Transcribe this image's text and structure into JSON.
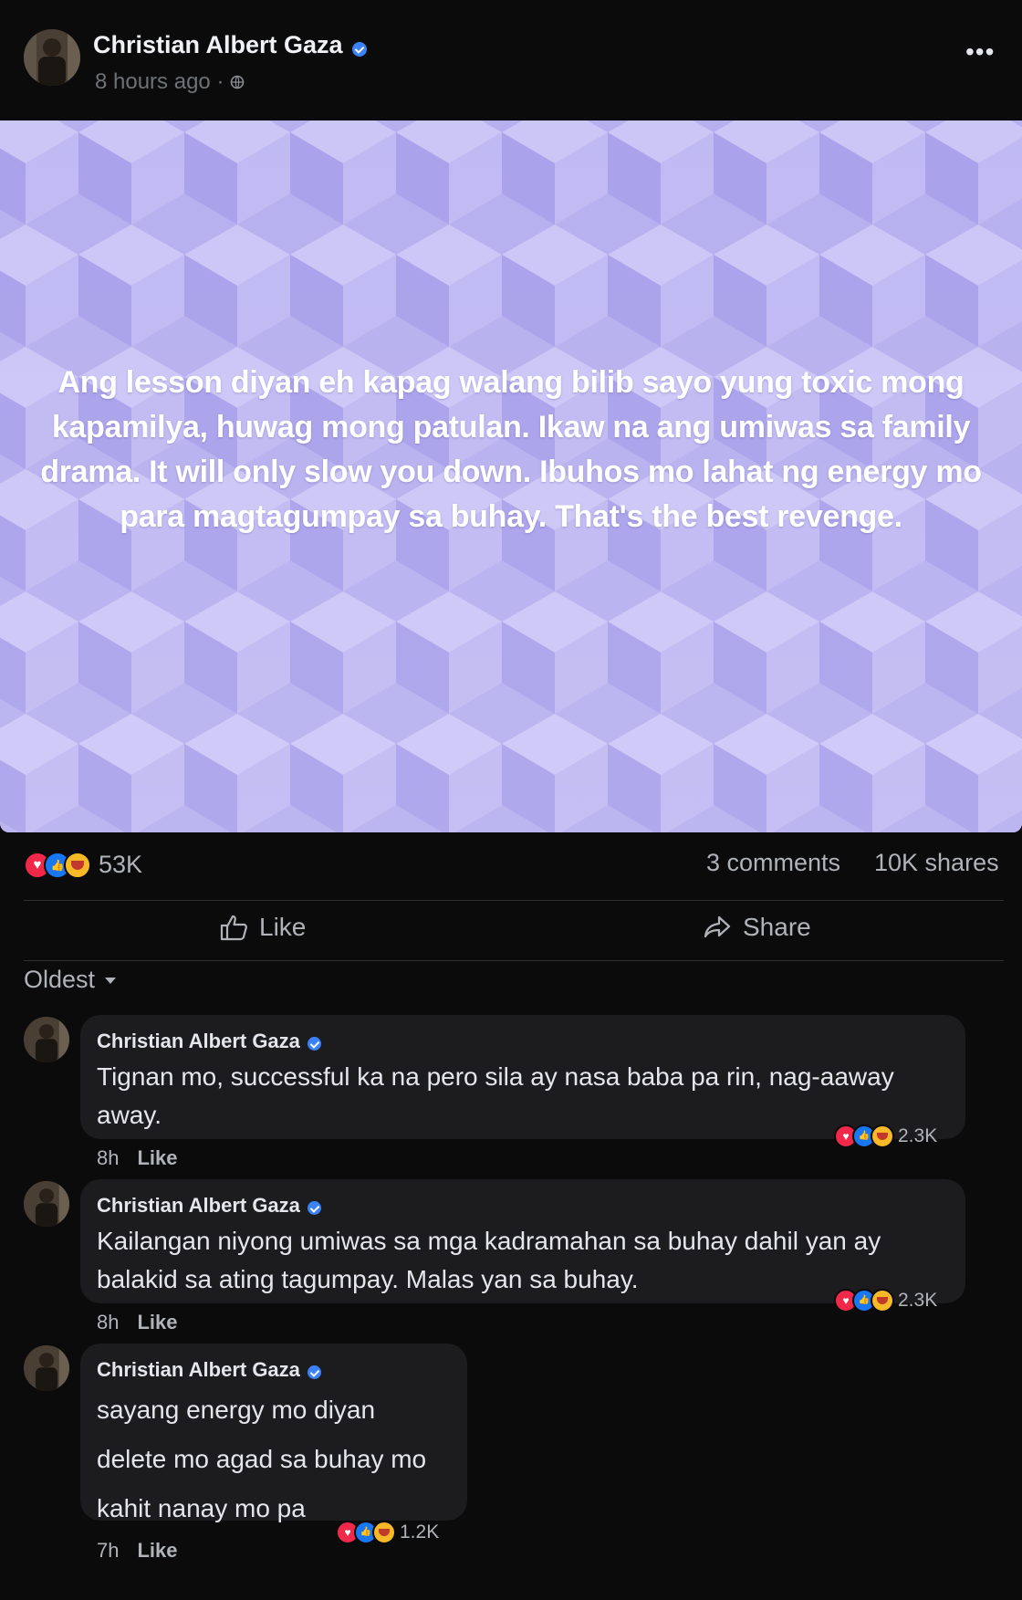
{
  "post": {
    "author": "Christian Albert Gaza",
    "time": "8 hours ago",
    "privacy_icon": "globe-icon",
    "more_icon": "more-options-icon",
    "text": "Ang lesson diyan eh kapag walang bilib sayo yung toxic mong kapamilya, huwag mong patulan. Ikaw na ang umiwas sa family drama. It will only slow you down. Ibuhos mo lahat ng energy mo para magtagumpay sa buhay. That's the best revenge.",
    "background_color": "#b5aef0"
  },
  "stats": {
    "reactions": "53K",
    "comments": "3 comments",
    "shares": "10K shares"
  },
  "actions": {
    "like": "Like",
    "share": "Share"
  },
  "sort": {
    "label": "Oldest"
  },
  "comments": [
    {
      "author": "Christian Albert Gaza",
      "lines": [
        "Tignan mo, successful ka na pero sila ay nasa baba pa rin, nag-aaway",
        "away."
      ],
      "time": "8h",
      "like": "Like",
      "reactions": "2.3K"
    },
    {
      "author": "Christian Albert Gaza",
      "lines": [
        "Kailangan niyong umiwas sa mga kadramahan sa buhay dahil yan ay",
        "balakid sa ating tagumpay. Malas yan sa buhay."
      ],
      "time": "8h",
      "like": "Like",
      "reactions": "2.3K"
    },
    {
      "author": "Christian Albert Gaza",
      "lines": [
        "sayang energy mo diyan",
        "delete mo agad sa buhay mo",
        "kahit nanay mo pa"
      ],
      "time": "7h",
      "like": "Like",
      "reactions": "1.2K"
    }
  ],
  "colors": {
    "background": "#0b0b0c",
    "bubble": "#1c1c1e",
    "verified": "#3b82f6",
    "love": "#f02849",
    "like": "#1877f2",
    "care": "#f7b928"
  }
}
